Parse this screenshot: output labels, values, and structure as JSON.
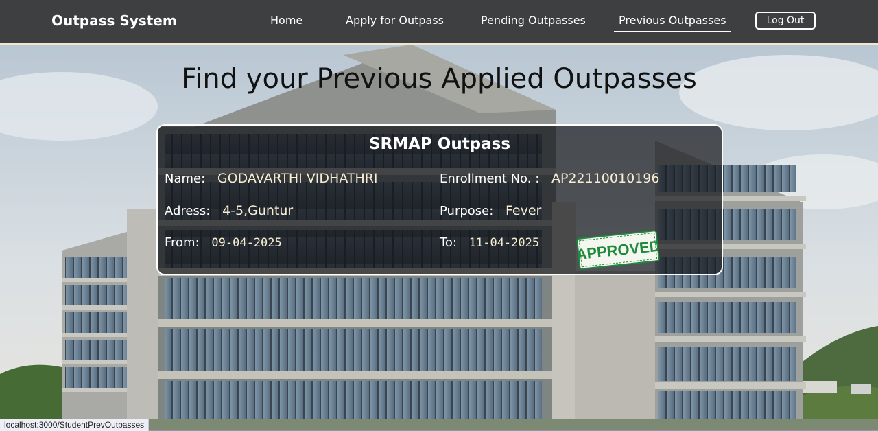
{
  "navbar": {
    "brand": "Outpass System",
    "links": [
      {
        "label": "Home"
      },
      {
        "label": "Apply for Outpass"
      },
      {
        "label": "Pending Outpasses"
      },
      {
        "label": "Previous Outpasses",
        "active": true
      }
    ],
    "logout_label": "Log Out"
  },
  "page": {
    "heading": "Find your Previous Applied Outpasses"
  },
  "card": {
    "title": "SRMAP Outpass",
    "name_label": "Name:",
    "name_value": "GODAVARTHI VIDHATHRI",
    "enrollment_label": "Enrollment No. :",
    "enrollment_value": "AP22110010196",
    "address_label": "Adress:",
    "address_value": "4-5,Guntur",
    "purpose_label": "Purpose:",
    "purpose_value": "Fever",
    "from_label": "From:",
    "from_value": "09-04-2025",
    "to_label": "To:",
    "to_value": "11-04-2025",
    "stamp_text": "APPROVED"
  },
  "statusbar": {
    "url": "localhost:3000/StudentPrevOutpasses"
  },
  "colors": {
    "navbar_bg": "#3d3f41",
    "card_bg": "rgba(20,22,26,0.70)",
    "value_text": "#f7edd2",
    "stamp_green": "#1f8a3c"
  }
}
